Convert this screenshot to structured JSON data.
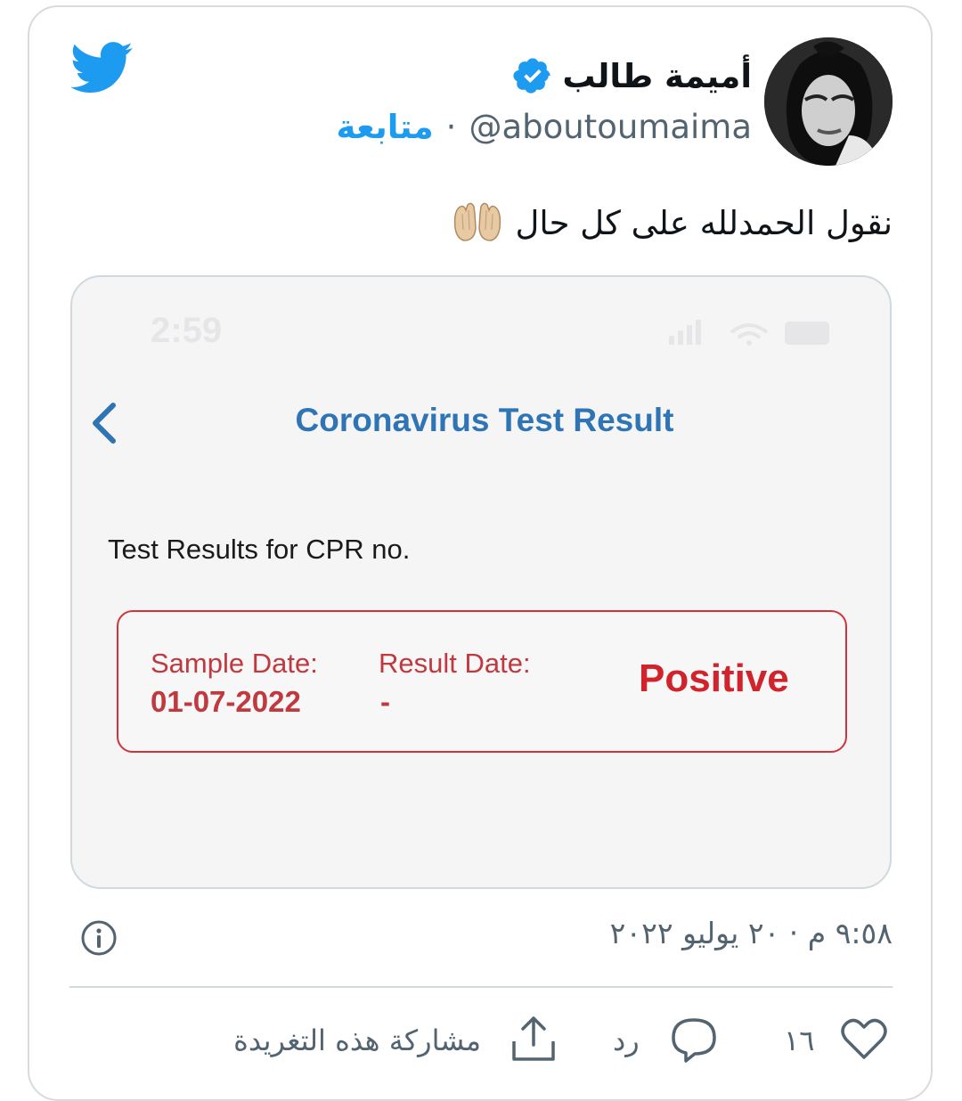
{
  "tweet": {
    "author_name": "أميمة طالب",
    "handle": "@aboutoumaima",
    "separator": "·",
    "follow_label": "متابعة",
    "text": "نقول الحمدلله على كل حال",
    "emoji": "palms-up-together-emoji",
    "timestamp": "٩:٥٨ م · ٢٠ يوليو ٢٠٢٢",
    "colors": {
      "accent": "#1d9bf0",
      "muted": "#536471",
      "border": "#cfd9de"
    }
  },
  "media": {
    "status_time": "2:59",
    "screen_title": "Coronavirus Test Result",
    "cpr_label": "Test Results for CPR no.",
    "sample_date_label": "Sample Date:",
    "sample_date_value": "01-07-2022",
    "result_date_label": "Result Date:",
    "result_date_value": "-",
    "result": "Positive",
    "colors": {
      "title": "#2f75b5",
      "result_red": "#d0232b",
      "box_border": "#d0333a"
    }
  },
  "actions": {
    "like_count": "١٦",
    "reply_label": "رد",
    "share_label": "مشاركة هذه التغريدة"
  },
  "icons": [
    "twitter-bird-icon",
    "verified-badge-icon",
    "info-icon",
    "heart-icon",
    "reply-bubble-icon",
    "share-upload-icon",
    "back-chevron-icon"
  ]
}
